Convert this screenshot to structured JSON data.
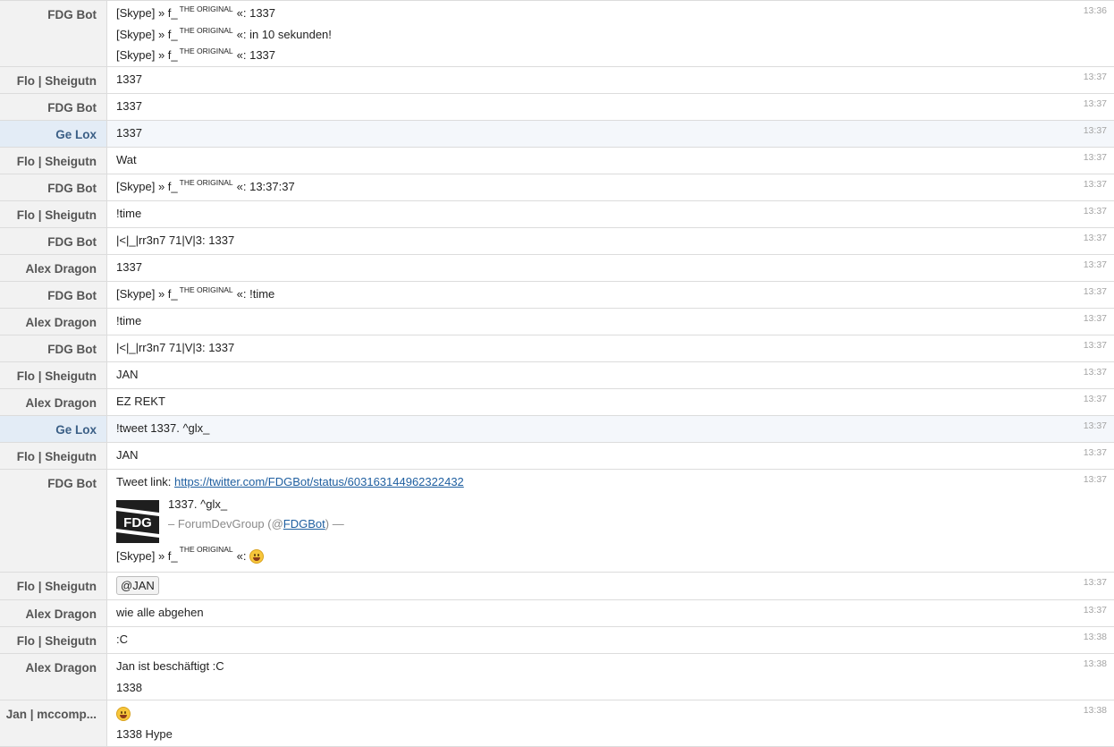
{
  "rows": [
    {
      "user": "FDG Bot",
      "time": "13:36",
      "lines": [
        {
          "pre": "[Skype] » f_",
          "sup": "THE ORIGINAL",
          "post": "«: 1337"
        },
        {
          "pre": "[Skype] » f_",
          "sup": "THE ORIGINAL",
          "post": "«: in 10 sekunden!"
        },
        {
          "pre": "[Skype] » f_",
          "sup": "THE ORIGINAL",
          "post": "«: 1337"
        }
      ]
    },
    {
      "user": "Flo | Sheigutn",
      "time": "13:37",
      "lines": [
        {
          "text": "1337"
        }
      ]
    },
    {
      "user": "FDG Bot",
      "time": "13:37",
      "lines": [
        {
          "text": "1337"
        }
      ]
    },
    {
      "user": "Ge Lox",
      "time": "13:37",
      "lines": [
        {
          "text": "1337"
        }
      ]
    },
    {
      "user": "Flo | Sheigutn",
      "time": "13:37",
      "lines": [
        {
          "text": "Wat"
        }
      ]
    },
    {
      "user": "FDG Bot",
      "time": "13:37",
      "lines": [
        {
          "pre": "[Skype] » f_",
          "sup": "THE ORIGINAL",
          "post": "«: 13:37:37"
        }
      ]
    },
    {
      "user": "Flo | Sheigutn",
      "time": "13:37",
      "lines": [
        {
          "text": "!time"
        }
      ]
    },
    {
      "user": "FDG Bot",
      "time": "13:37",
      "lines": [
        {
          "text": "|<|_|rr3n7 71|V|3: 1337"
        }
      ]
    },
    {
      "user": "Alex Dragon",
      "time": "13:37",
      "lines": [
        {
          "text": "1337"
        }
      ]
    },
    {
      "user": "FDG Bot",
      "time": "13:37",
      "lines": [
        {
          "pre": "[Skype] » f_",
          "sup": "THE ORIGINAL",
          "post": "«: !time"
        }
      ]
    },
    {
      "user": "Alex Dragon",
      "time": "13:37",
      "lines": [
        {
          "text": "!time"
        }
      ]
    },
    {
      "user": "FDG Bot",
      "time": "13:37",
      "lines": [
        {
          "text": "|<|_|rr3n7 71|V|3: 1337"
        }
      ]
    },
    {
      "user": "Flo | Sheigutn",
      "time": "13:37",
      "lines": [
        {
          "text": "JAN"
        }
      ]
    },
    {
      "user": "Alex Dragon",
      "time": "13:37",
      "lines": [
        {
          "text": "EZ REKT"
        }
      ]
    },
    {
      "user": "Ge Lox",
      "time": "13:37",
      "lines": [
        {
          "text": "!tweet 1337. ^glx_"
        }
      ]
    },
    {
      "user": "Flo | Sheigutn",
      "time": "13:37",
      "lines": [
        {
          "text": "JAN"
        }
      ]
    }
  ],
  "tweet_row": {
    "user": "FDG Bot",
    "time": "13:37",
    "link_prefix": "Tweet link: ",
    "link_url": "https://twitter.com/FDGBot/status/603163144962322432",
    "embed": {
      "logo_text": "FDG",
      "title": "1337. ^glx_",
      "author_prefix": "– ForumDevGroup (@",
      "author_handle": "FDGBot",
      "author_suffix": ") —",
      "foot_pre": "[Skype] » f_",
      "foot_sup": "THE ORIGINAL",
      "foot_post": "«:",
      "foot_emoji": "grinning-emoji"
    }
  },
  "rows2": [
    {
      "user": "Flo | Sheigutn",
      "time": "13:37",
      "mention": "@JAN"
    },
    {
      "user": "Alex Dragon",
      "time": "13:37",
      "text": "wie alle abgehen"
    },
    {
      "user": "Flo | Sheigutn",
      "time": "13:38",
      "text": ":C"
    },
    {
      "user": "Alex Dragon",
      "time": "13:38",
      "lines": [
        "Jan ist beschäftigt :C",
        "1338"
      ]
    },
    {
      "user": "Jan | mccomp...",
      "time": "13:38",
      "emoji": "smile-emoji",
      "lines": [
        "1338 Hype"
      ]
    }
  ]
}
